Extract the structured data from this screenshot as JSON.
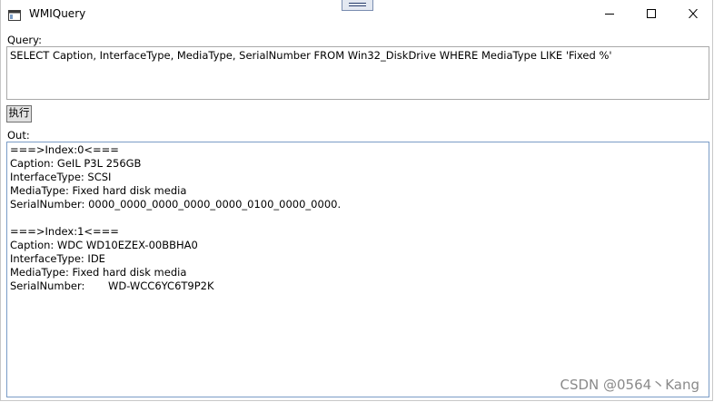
{
  "window": {
    "title": "WMIQuery",
    "icon": "window-app-icon",
    "controls": [
      "minimize-icon",
      "maximize-icon",
      "close-icon"
    ]
  },
  "query": {
    "label": "Query:",
    "value": "SELECT Caption, InterfaceType, MediaType, SerialNumber FROM Win32_DiskDrive WHERE MediaType LIKE 'Fixed %'"
  },
  "execute_button": {
    "label": "执行"
  },
  "output": {
    "label": "Out:",
    "lines": [
      "===>Index:0<===",
      "Caption: GeIL P3L 256GB",
      "InterfaceType: SCSI",
      "MediaType: Fixed hard disk media",
      "SerialNumber: 0000_0000_0000_0000_0000_0100_0000_0000.",
      "",
      "===>Index:1<===",
      "Caption: WDC WD10EZEX-00BBHA0",
      "InterfaceType: IDE",
      "MediaType: Fixed hard disk media",
      "SerialNumber:       WD-WCC6YC6T9P2K"
    ]
  },
  "watermark": "CSDN @0564丶Kang",
  "colors": {
    "output_border": "#7a9cc6",
    "input_border": "#a9a9a9",
    "button_face": "#e1e1e1"
  }
}
